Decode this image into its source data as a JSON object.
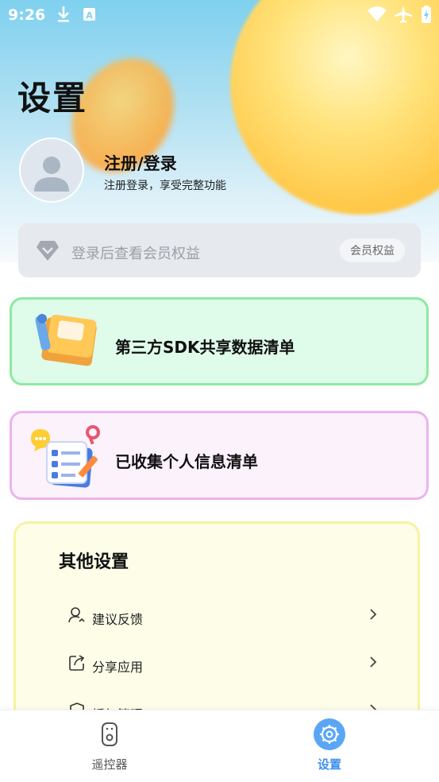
{
  "status_bar": {
    "time": "9:26",
    "icons_left": [
      "download-icon",
      "a-badge-icon"
    ],
    "icons_right": [
      "wifi-icon",
      "airplane-icon",
      "battery-icon"
    ]
  },
  "page": {
    "title": "设置"
  },
  "profile": {
    "name": "注册/登录",
    "subtitle": "注册登录，享受完整功能"
  },
  "membership": {
    "prompt": "登录后查看会员权益",
    "button_label": "会员权益"
  },
  "cards": [
    {
      "label": "第三方SDK共享数据清单",
      "icon": "folder-tools-illustration"
    },
    {
      "label": "已收集个人信息清单",
      "icon": "checklist-illustration"
    }
  ],
  "other_settings": {
    "title": "其他设置",
    "items": [
      {
        "label": "建议反馈",
        "icon": "person-feedback-icon"
      },
      {
        "label": "分享应用",
        "icon": "share-icon"
      },
      {
        "label": "授权管理",
        "icon": "shield-icon"
      }
    ]
  },
  "tabbar": {
    "tabs": [
      {
        "label": "遥控器",
        "icon": "remote-icon",
        "active": false
      },
      {
        "label": "设置",
        "icon": "gear-icon",
        "active": true
      }
    ]
  },
  "colors": {
    "accent": "#3c8ff0",
    "tab_inactive": "#555555",
    "sdk_card_bg": "#dffbea",
    "sdk_card_border": "#8ee9a2",
    "info_card_bg": "#fbf2fb",
    "info_card_border": "#ecb3ee",
    "other_card_bg": "#fdfde8",
    "other_card_border": "#f6f3a0"
  }
}
